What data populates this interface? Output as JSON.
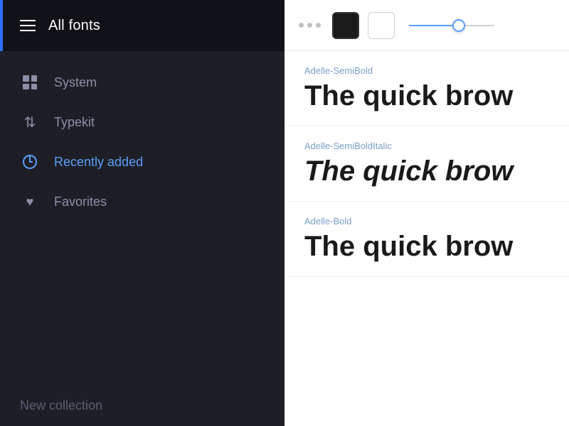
{
  "sidebar": {
    "header": {
      "title": "All fonts",
      "menu_icon": "hamburger-icon"
    },
    "nav_items": [
      {
        "id": "system",
        "label": "System",
        "icon": "windows-icon",
        "active": false
      },
      {
        "id": "typekit",
        "label": "Typekit",
        "icon": "typekit-icon",
        "active": false
      },
      {
        "id": "recently-added",
        "label": "Recently added",
        "icon": "clock-icon",
        "active": true
      },
      {
        "id": "favorites",
        "label": "Favorites",
        "icon": "heart-icon",
        "active": false
      }
    ],
    "new_collection_label": "New collection"
  },
  "toolbar": {
    "dots_label": "···",
    "dark_swatch_label": "Dark color",
    "light_swatch_label": "Light color",
    "slider_label": "Font size slider",
    "slider_value": 60
  },
  "font_list": [
    {
      "id": "adelle-semibold",
      "name": "Adelle-SemiBold",
      "preview": "The quick brow",
      "style": "semibold"
    },
    {
      "id": "adelle-semibolditalic",
      "name": "Adelle-SemiBoldItalic",
      "preview": "The quick brow",
      "style": "semibold-italic"
    },
    {
      "id": "adelle-bold",
      "name": "Adelle-Bold",
      "preview": "The quick brow",
      "style": "bold"
    }
  ]
}
